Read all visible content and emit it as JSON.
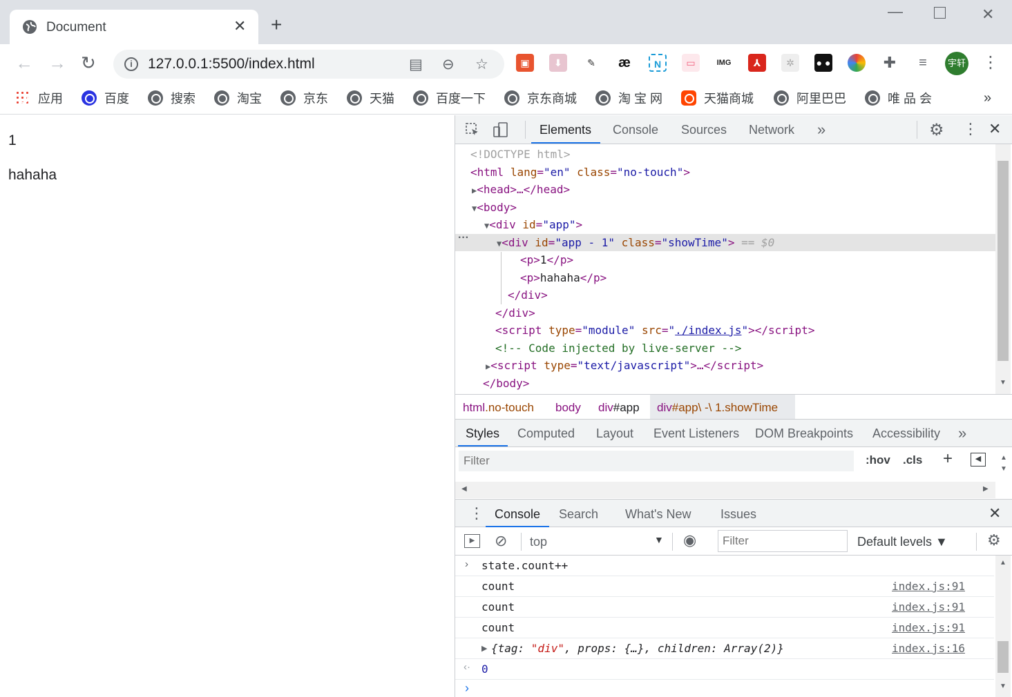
{
  "browser": {
    "tab_title": "Document",
    "url": "127.0.0.1:5500/index.html",
    "avatar_text": "宇轩",
    "bookmarks": [
      {
        "label": "应用",
        "icon": "apps-grid-icon"
      },
      {
        "label": "百度",
        "icon": "baidu-icon"
      },
      {
        "label": "搜索",
        "icon": "globe-icon"
      },
      {
        "label": "淘宝",
        "icon": "globe-icon"
      },
      {
        "label": "京东",
        "icon": "globe-icon"
      },
      {
        "label": "天猫",
        "icon": "globe-icon"
      },
      {
        "label": "百度一下",
        "icon": "globe-icon"
      },
      {
        "label": "京东商城",
        "icon": "globe-icon"
      },
      {
        "label": "淘 宝 网",
        "icon": "globe-icon"
      },
      {
        "label": "天猫商城",
        "icon": "taobao-icon"
      },
      {
        "label": "阿里巴巴",
        "icon": "globe-icon"
      },
      {
        "label": "唯 品 会",
        "icon": "globe-icon"
      }
    ],
    "bookmarks_more": "»"
  },
  "page": {
    "p1": "1",
    "p2": "hahaha"
  },
  "devtools": {
    "main_tabs": [
      "Elements",
      "Console",
      "Sources",
      "Network"
    ],
    "more": "»",
    "elements": {
      "doctype": "<!DOCTYPE html>",
      "html_open": {
        "tag": "html",
        "attr1": "lang",
        "val1": "en",
        "attr2": "class",
        "val2": "no-touch"
      },
      "head": "<head>…</head>",
      "body_open": "<body>",
      "div_app": {
        "attr": "id",
        "val": "app"
      },
      "div_selected": {
        "attr1": "id",
        "val1": "app - 1",
        "attr2": "class",
        "val2": "showTime",
        "suffix": "== $0"
      },
      "p1": "1",
      "p2": "hahaha",
      "close_div_inner": "</div>",
      "close_div_outer": "</div>",
      "script_module": {
        "attr1": "type",
        "val1": "module",
        "attr2": "src",
        "val2": "./index.js"
      },
      "comment": "<!-- Code injected by live-server -->",
      "script_js": {
        "attr": "type",
        "val": "text/javascript"
      },
      "body_close": "</body>"
    },
    "breadcrumbs": [
      {
        "tag": "html",
        "cls": ".no-touch"
      },
      {
        "tag": "body",
        "cls": ""
      },
      {
        "tag": "div",
        "cls": "#app"
      },
      {
        "tag": "div",
        "cls": "#app\\ -\\ 1.showTime"
      }
    ],
    "styles_tabs": [
      "Styles",
      "Computed",
      "Layout",
      "Event Listeners",
      "DOM Breakpoints",
      "Accessibility"
    ],
    "styles_filter_placeholder": "Filter",
    "hov": ":hov",
    "cls": ".cls",
    "drawer_tabs": [
      "Console",
      "Search",
      "What's New",
      "Issues"
    ],
    "console_context": "top",
    "console_filter_placeholder": "Filter",
    "levels": "Default levels ▼",
    "console": {
      "input": "state.count++",
      "logs": [
        {
          "msg": "count",
          "src": "index.js:91"
        },
        {
          "msg": "count",
          "src": "index.js:91"
        },
        {
          "msg": "count",
          "src": "index.js:91"
        }
      ],
      "object": {
        "pre": "{tag: ",
        "tag": "\"div\"",
        "mid": ", props: {…}, children: Array(2)}",
        "src": "index.js:16"
      },
      "result": "0"
    }
  }
}
